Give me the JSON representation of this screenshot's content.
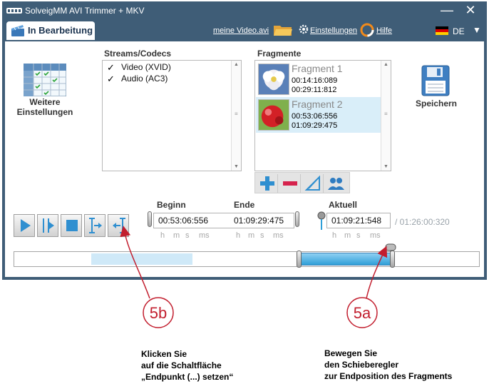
{
  "window": {
    "title": "SolveigMM AVI Trimmer + MKV",
    "minimize_glyph": "—",
    "close_glyph": "✕",
    "title_bar_color": "#3f5d77"
  },
  "toolbar": {
    "active_tab": "In Bearbeitung",
    "file_link": "meine Video.avi",
    "settings_link": "Einstellungen",
    "help_link": "Hilfe",
    "language": "DE",
    "language_chevron": "▼",
    "icons": [
      "folder-icon",
      "gear-icon",
      "help-icon",
      "flag-de-icon"
    ]
  },
  "left_panel": {
    "settings_button_label": "Weitere Einstellungen"
  },
  "streams": {
    "title": "Streams/Codecs",
    "items": [
      {
        "label": "Video (XVID)",
        "checked": true,
        "check_glyph": "✓"
      },
      {
        "label": "Audio (AC3)",
        "checked": true,
        "check_glyph": "✓"
      }
    ]
  },
  "fragments": {
    "title": "Fragmente",
    "items": [
      {
        "name": "Fragment 1",
        "start": "00:14:16:089",
        "end": "00:29:11:812",
        "selected": false
      },
      {
        "name": "Fragment 2",
        "start": "00:53:06:556",
        "end": "01:09:29:475",
        "selected": true
      }
    ],
    "toolbar_icons": [
      "add-fragment-icon",
      "remove-fragment-icon",
      "edit-fragment-icon",
      "users-icon"
    ]
  },
  "save": {
    "label": "Speichern"
  },
  "playback": {
    "buttons": [
      "play-icon",
      "go-to-start-icon",
      "stop-icon",
      "set-start-icon",
      "set-end-icon"
    ]
  },
  "times": {
    "start_label": "Beginn",
    "start_value": "00:53:06:556",
    "end_label": "Ende",
    "end_value": "01:09:29:475",
    "current_label": "Aktuell",
    "current_value": "01:09:21:548",
    "total": "/ 01:26:00:320",
    "unit_h": "h",
    "unit_m": "m",
    "unit_s": "s",
    "unit_ms": "ms"
  },
  "timeline": {
    "accent_color": "#2f9fd8"
  },
  "callouts": {
    "b_label": "5b",
    "b_note_line1": "Klicken Sie",
    "b_note_line2": "auf die Schaltfläche",
    "b_note_line3": "„Endpunkt (...) setzen“",
    "a_label": "5a",
    "a_note_line1": "Bewegen Sie",
    "a_note_line2": "den Schieberegler",
    "a_note_line3": "zur Endposition des Fragments",
    "color": "#c21e2e"
  }
}
